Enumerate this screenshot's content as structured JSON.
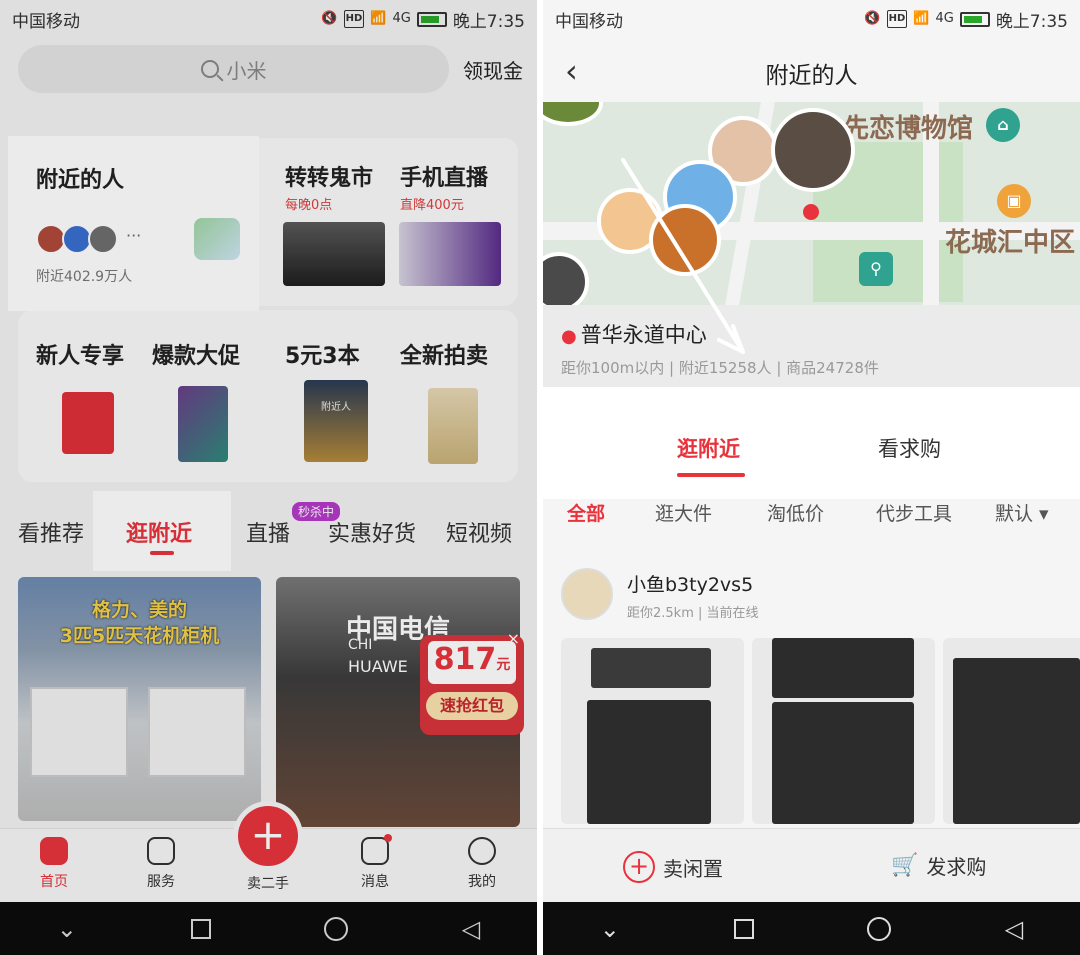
{
  "status_bar": {
    "carrier": "中国移动",
    "hd": "HD",
    "network": "4G",
    "time": "晚上7:35"
  },
  "left": {
    "search": {
      "placeholder": "小米",
      "cash_link": "领现金"
    },
    "nearby_people": {
      "title": "附近的人",
      "count": "附近402.9万人",
      "more": "···"
    },
    "tiles": [
      {
        "title": "转转鬼市",
        "sub": "每晚0点"
      },
      {
        "title": "手机直播",
        "sub": "直降400元"
      },
      {
        "title": "新人专享",
        "sub": ""
      },
      {
        "title": "爆款大促",
        "sub": ""
      },
      {
        "title": "5元3本",
        "sub": ""
      },
      {
        "title": "全新拍卖",
        "sub": ""
      }
    ],
    "book_title": "附近人",
    "tabs": [
      "看推荐",
      "逛附近",
      "直播",
      "实惠好货",
      "短视频"
    ],
    "flash_badge": "秒杀中",
    "feed": {
      "card1_text": "格力、美的\n3匹5匹天花机柜机",
      "card2_sign": "中国电信",
      "card2_sub": "CHI",
      "card2_brand": "HUAWE",
      "promo_value": "817",
      "promo_unit": "元",
      "promo_button": "速抢红包",
      "promo_close": "×"
    },
    "bottom_nav": [
      {
        "label": "首页",
        "icon": "home-icon"
      },
      {
        "label": "服务",
        "icon": "service-icon"
      },
      {
        "label": "卖二手",
        "icon": "sell-plus-icon"
      },
      {
        "label": "消息",
        "icon": "message-icon"
      },
      {
        "label": "我的",
        "icon": "profile-icon"
      }
    ],
    "sell_plus": "+"
  },
  "right": {
    "header": {
      "title": "附近的人",
      "back": "‹"
    },
    "map_labels": [
      "先恋博物馆",
      "花城汇中区"
    ],
    "place": {
      "name": "普华永道中心",
      "stats": "距你100m以内 | 附近15258人 | 商品24728件"
    },
    "segments": [
      "逛附近",
      "看求购"
    ],
    "filters": [
      "全部",
      "逛大件",
      "淘低价",
      "代步工具",
      "默认 ▾"
    ],
    "seller": {
      "name": "小鱼b3ty2vs5",
      "meta": "距你2.5km | 当前在线"
    },
    "bottom_actions": [
      {
        "label": "卖闲置",
        "icon": "plus-circle-icon"
      },
      {
        "label": "发求购",
        "icon": "cart-icon"
      }
    ],
    "plus": "+",
    "cart": "🛒"
  },
  "sysnav": {
    "down": "⌄",
    "back": "◁"
  },
  "colors": {
    "accent": "#e8333d",
    "purple_badge": "#b53ac9"
  }
}
